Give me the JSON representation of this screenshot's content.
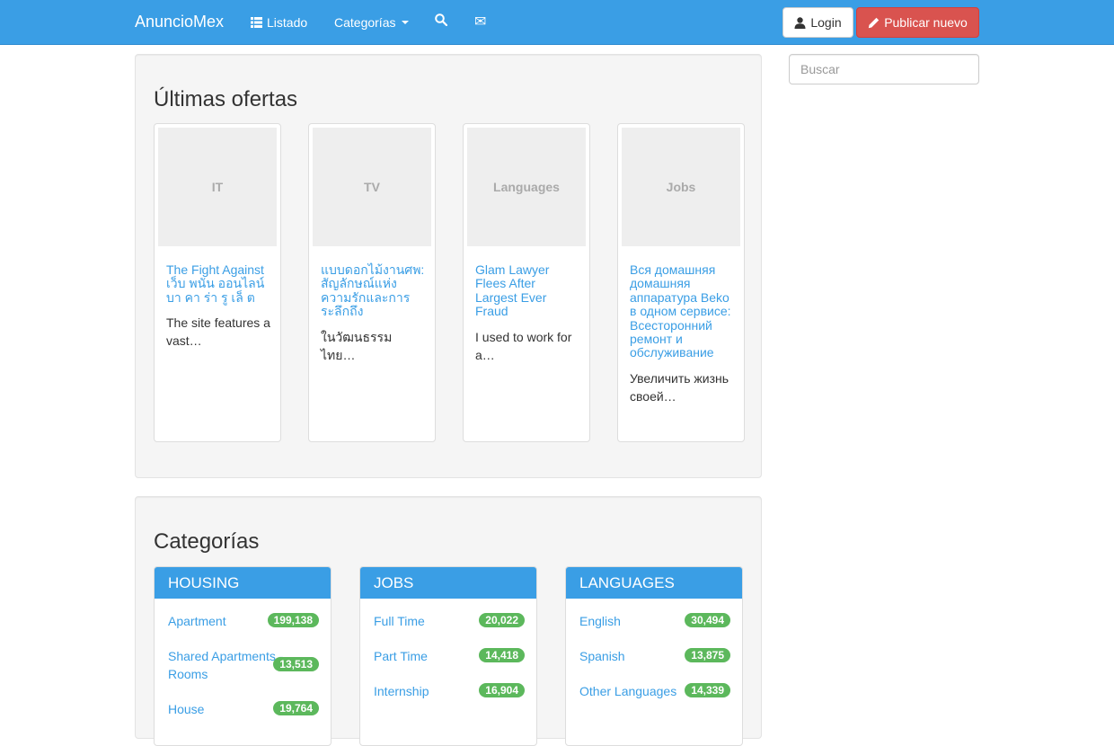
{
  "navbar": {
    "brand": "AnuncioMex",
    "listado_label": "Listado",
    "categorias_label": "Categorías",
    "login_label": "Login",
    "publish_label": "Publicar nuevo"
  },
  "search": {
    "placeholder": "Buscar"
  },
  "offers": {
    "title": "Últimas ofertas",
    "items": [
      {
        "image_label": "IT",
        "title": "The Fight Against เว็บ พนัน ออนไลน์ บา คา ร่า รู เล็ ต",
        "desc": "The site features a vast…"
      },
      {
        "image_label": "TV",
        "title": "แบบดอกไม้งานศพ: สัญลักษณ์แห่งความรักและการระลึกถึง",
        "desc": "ในวัฒนธรรมไทย…"
      },
      {
        "image_label": "Languages",
        "title": "Glam Lawyer Flees After Largest Ever Fraud",
        "desc": "I used to work for a…"
      },
      {
        "image_label": "Jobs",
        "title": "Вся домашняя домашняя аппаратура Beko в одном сервисе: Всесторонний ремонт и обслуживание",
        "desc": "Увеличить жизнь своей…"
      }
    ]
  },
  "categories": {
    "title": "Categorías",
    "groups": [
      {
        "name": "HOUSING",
        "items": [
          {
            "label": "Apartment",
            "count": "199,138"
          },
          {
            "label": "Shared Apartments - Rooms",
            "count": "13,513"
          },
          {
            "label": "House",
            "count": "19,764"
          }
        ]
      },
      {
        "name": "JOBS",
        "items": [
          {
            "label": "Full Time",
            "count": "20,022"
          },
          {
            "label": "Part Time",
            "count": "14,418"
          },
          {
            "label": "Internship",
            "count": "16,904"
          }
        ]
      },
      {
        "name": "LANGUAGES",
        "items": [
          {
            "label": "English",
            "count": "30,494"
          },
          {
            "label": "Spanish",
            "count": "13,875"
          },
          {
            "label": "Other Languages",
            "count": "14,339"
          }
        ]
      }
    ]
  },
  "colors": {
    "primary": "#3a9ee5",
    "danger": "#d9534f",
    "badge": "#5cb85c"
  }
}
